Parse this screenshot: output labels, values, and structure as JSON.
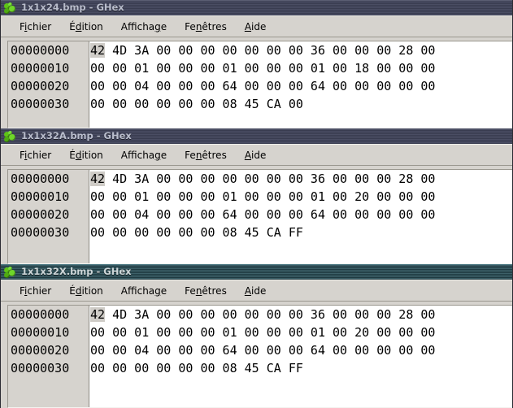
{
  "app": {
    "name": "GHex",
    "icon": "ghex-molecule-icon"
  },
  "menu": {
    "items": [
      {
        "label": "Fichier",
        "pre": "F",
        "mnemonic": "i",
        "post": "chier",
        "name": "menu-fichier"
      },
      {
        "label": "Édition",
        "pre": "É",
        "mnemonic": "d",
        "post": "ition",
        "name": "menu-edition"
      },
      {
        "label": "Affichage",
        "pre": "Afficha",
        "mnemonic": "g",
        "post": "e",
        "name": "menu-affichage"
      },
      {
        "label": "Fenêtres",
        "pre": "Fe",
        "mnemonic": "n",
        "post": "êtres",
        "name": "menu-fenetres"
      },
      {
        "label": "Aide",
        "pre": "",
        "mnemonic": "A",
        "post": "ide",
        "name": "menu-aide"
      }
    ]
  },
  "colors": {
    "titlebar_inactive": "#393c50",
    "titlebar_active": "#1f3a41",
    "title_text": "#b9bdcc",
    "window_bg": "#d6d3ce",
    "hex_bg": "#ffffff",
    "gutter_bg": "#d6d3ce",
    "cursor_highlight": "#cfccc7",
    "icon_green": "#5ec417",
    "desktop": "#6b7f91"
  },
  "windows": [
    {
      "title": "1x1x24.bmp - GHex",
      "filename": "1x1x24.bmp",
      "active": false,
      "rows": [
        {
          "offset": "00000000",
          "bytes": "42 4D 3A 00 00 00 00 00 00 00 36 00 00 00 28 00"
        },
        {
          "offset": "00000010",
          "bytes": "00 00 01 00 00 00 01 00 00 00 01 00 18 00 00 00"
        },
        {
          "offset": "00000020",
          "bytes": "00 00 04 00 00 00 64 00 00 00 64 00 00 00 00 00"
        },
        {
          "offset": "00000030",
          "bytes": "00 00 00 00 00 00 08 45 CA 00"
        }
      ]
    },
    {
      "title": "1x1x32A.bmp - GHex",
      "filename": "1x1x32A.bmp",
      "active": false,
      "rows": [
        {
          "offset": "00000000",
          "bytes": "42 4D 3A 00 00 00 00 00 00 00 36 00 00 00 28 00"
        },
        {
          "offset": "00000010",
          "bytes": "00 00 01 00 00 00 01 00 00 00 01 00 20 00 00 00"
        },
        {
          "offset": "00000020",
          "bytes": "00 00 04 00 00 00 64 00 00 00 64 00 00 00 00 00"
        },
        {
          "offset": "00000030",
          "bytes": "00 00 00 00 00 00 08 45 CA FF"
        }
      ]
    },
    {
      "title": "1x1x32X.bmp - GHex",
      "filename": "1x1x32X.bmp",
      "active": true,
      "rows": [
        {
          "offset": "00000000",
          "bytes": "42 4D 3A 00 00 00 00 00 00 00 36 00 00 00 28 00"
        },
        {
          "offset": "00000010",
          "bytes": "00 00 01 00 00 00 01 00 00 00 01 00 20 00 00 00"
        },
        {
          "offset": "00000020",
          "bytes": "00 00 04 00 00 00 64 00 00 00 64 00 00 00 00 00"
        },
        {
          "offset": "00000030",
          "bytes": "00 00 00 00 00 00 08 45 CA FF"
        }
      ]
    }
  ]
}
